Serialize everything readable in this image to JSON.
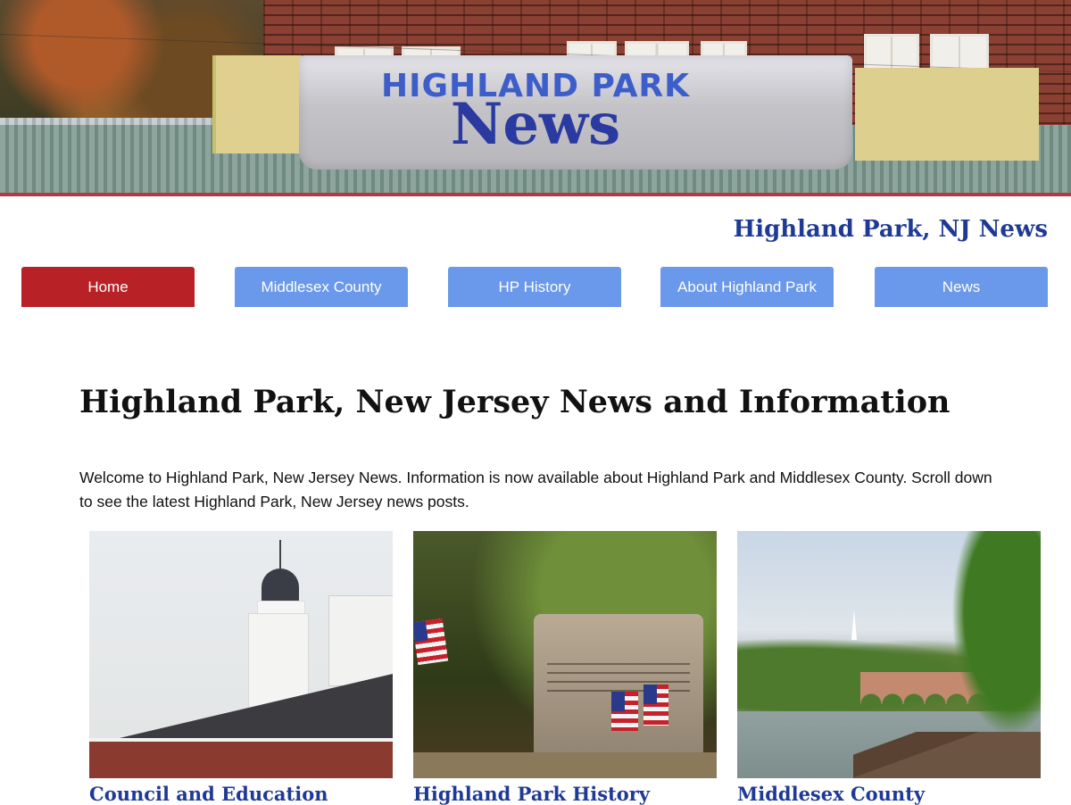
{
  "header": {
    "banner_line1": "HIGHLAND PARK",
    "banner_line2": "News",
    "site_title": "Highland Park, NJ News"
  },
  "nav": {
    "items": [
      {
        "label": "Home",
        "active": true
      },
      {
        "label": "Middlesex County",
        "active": false
      },
      {
        "label": "HP History",
        "active": false
      },
      {
        "label": "About Highland Park",
        "active": false
      },
      {
        "label": "News",
        "active": false
      }
    ],
    "active_color": "#b82126",
    "inactive_color": "#6a98ea"
  },
  "main": {
    "title": "Highland Park, New Jersey News and Information",
    "intro": "Welcome to Highland Park, New Jersey News. Information is now available about Highland Park and Middlesex County. Scroll down to see the latest Highland Park, New Jersey news posts.",
    "cards": [
      {
        "title": "Council and Education"
      },
      {
        "title": "Highland Park History"
      },
      {
        "title": "Middlesex County"
      }
    ]
  },
  "colors": {
    "link_blue": "#1f3a96",
    "banner_rule": "#b33a44"
  }
}
